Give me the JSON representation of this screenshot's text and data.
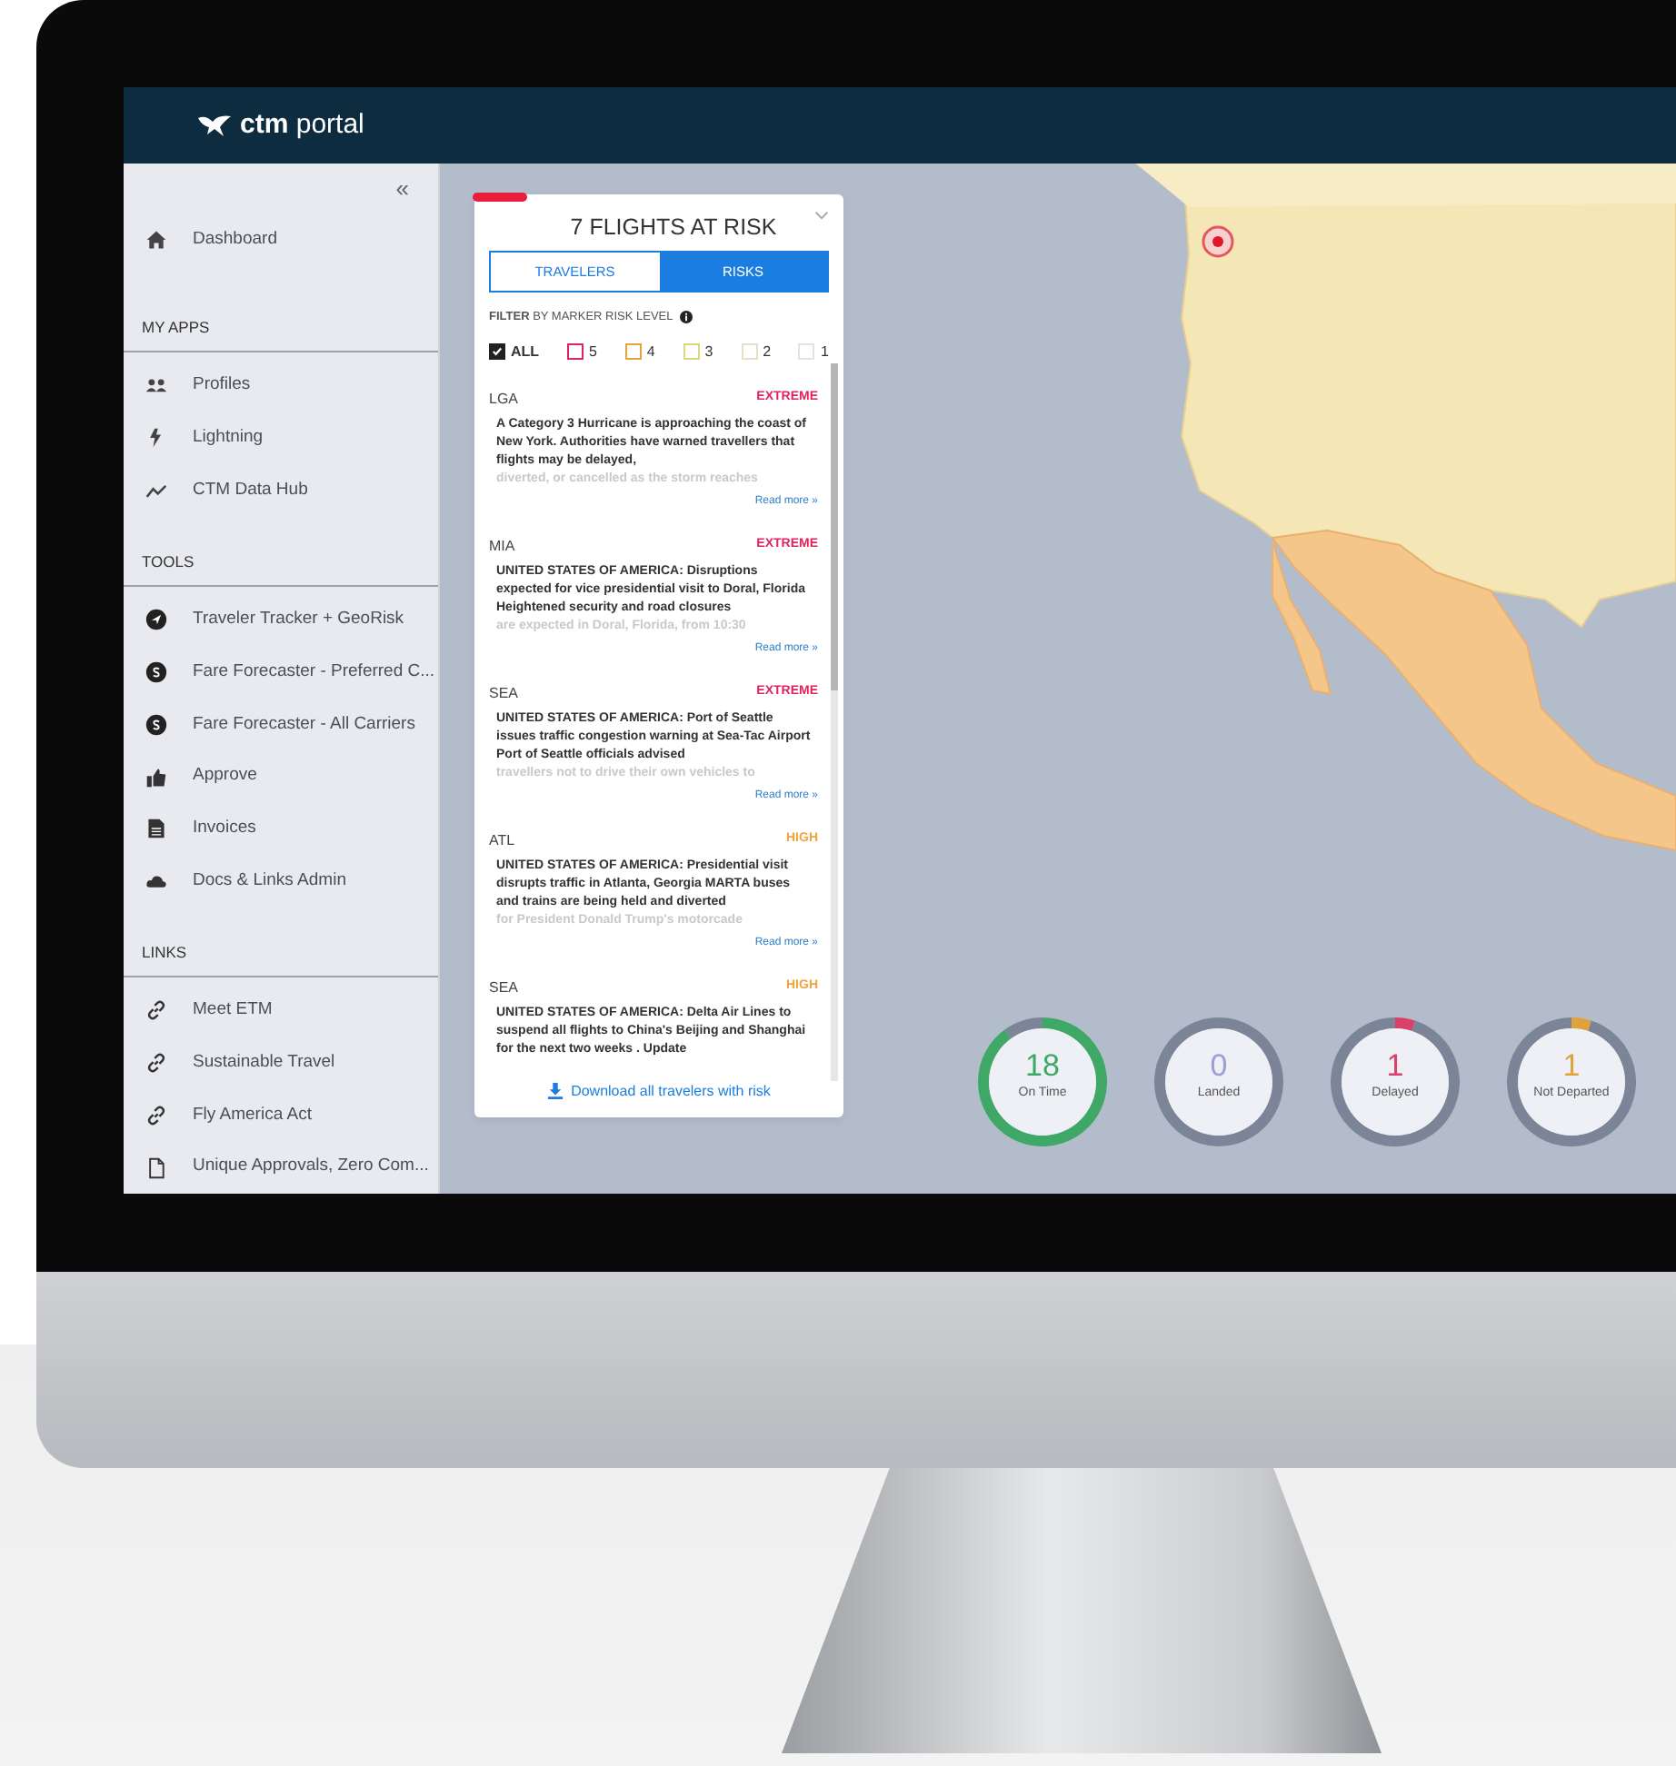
{
  "header": {
    "logo": "**ctm** portal"
  },
  "sidebar": {
    "collapse": "«",
    "items": [
      {
        "label": "Dashboard"
      }
    ],
    "sections": [
      {
        "title": "MY APPS",
        "items": [
          {
            "label": "Profiles"
          },
          {
            "label": "Lightning"
          },
          {
            "label": "CTM Data Hub"
          }
        ]
      },
      {
        "title": "TOOLS",
        "items": [
          {
            "label": "Traveler Tracker + GeoRisk"
          },
          {
            "label": "Fare Forecaster - Preferred C..."
          },
          {
            "label": "Fare Forecaster - All Carriers"
          },
          {
            "label": "Approve"
          },
          {
            "label": "Invoices"
          },
          {
            "label": "Docs & Links Admin"
          }
        ]
      },
      {
        "title": "LINKS",
        "items": [
          {
            "label": "Meet ETM"
          },
          {
            "label": "Sustainable Travel"
          },
          {
            "label": "Fly America Act"
          },
          {
            "label": "Unique Approvals, Zero Com..."
          }
        ]
      }
    ]
  },
  "risk_panel": {
    "title": "7 FLIGHTS AT RISK",
    "tabs": [
      {
        "label": "TRAVELERS",
        "selected": false
      },
      {
        "label": "RISKS",
        "selected": true
      }
    ],
    "filter_label": "**FILTER** BY MARKER RISK LEVEL",
    "filters": [
      {
        "label": "ALL",
        "checked": true,
        "color": "#222222"
      },
      {
        "label": "5",
        "checked": false,
        "color": "#e0245e"
      },
      {
        "label": "4",
        "checked": false,
        "color": "#e3a43c"
      },
      {
        "label": "3",
        "checked": false,
        "color": "#dcd77a"
      },
      {
        "label": "2",
        "checked": false,
        "color": "#e6e0c8"
      },
      {
        "label": "1",
        "checked": false,
        "color": "#e2e2e2"
      }
    ],
    "risks": [
      {
        "code": "LGA",
        "severity": "EXTREME",
        "color": "#e0245e",
        "text": "A Category 3 Hurricane is approaching the coast of New York. Authorities have warned travellers that flights may be delayed,",
        "faded": "diverted, or cancelled as the storm reaches",
        "read_more": "Read more »"
      },
      {
        "code": "MIA",
        "severity": "EXTREME",
        "color": "#e0245e",
        "text": "UNITED STATES OF AMERICA: Disruptions expected for vice presidential visit to Doral, Florida Heightened security and road closures",
        "faded": "are expected in Doral, Florida, from 10:30",
        "read_more": "Read more »"
      },
      {
        "code": "SEA",
        "severity": "EXTREME",
        "color": "#e0245e",
        "text": "UNITED STATES OF AMERICA: Port of Seattle issues traffic congestion warning at Sea-Tac Airport Port of Seattle officials advised",
        "faded": "travellers not to drive their own vehicles to",
        "read_more": "Read more »"
      },
      {
        "code": "ATL",
        "severity": "HIGH",
        "color": "#f2a33a",
        "text": "UNITED STATES OF AMERICA: Presidential visit disrupts traffic in Atlanta, Georgia MARTA buses and trains are being held and diverted",
        "faded": "for President Donald Trump's motorcade",
        "read_more": "Read more »"
      },
      {
        "code": "SEA",
        "severity": "HIGH",
        "color": "#f2a33a",
        "text": "UNITED STATES OF AMERICA: Delta Air Lines to suspend all flights to China's Beijing and Shanghai for the next two weeks . Update"
      }
    ],
    "download": "Download all travelers with risk"
  },
  "stats": [
    {
      "value": "18",
      "label": "On Time",
      "color": "#3fa866"
    },
    {
      "value": "0",
      "label": "Landed",
      "color": "#9a9fd8"
    },
    {
      "value": "1",
      "label": "Delayed",
      "color": "#d9416a"
    },
    {
      "value": "1",
      "label": "Not Departed",
      "color": "#e0a33c"
    }
  ]
}
